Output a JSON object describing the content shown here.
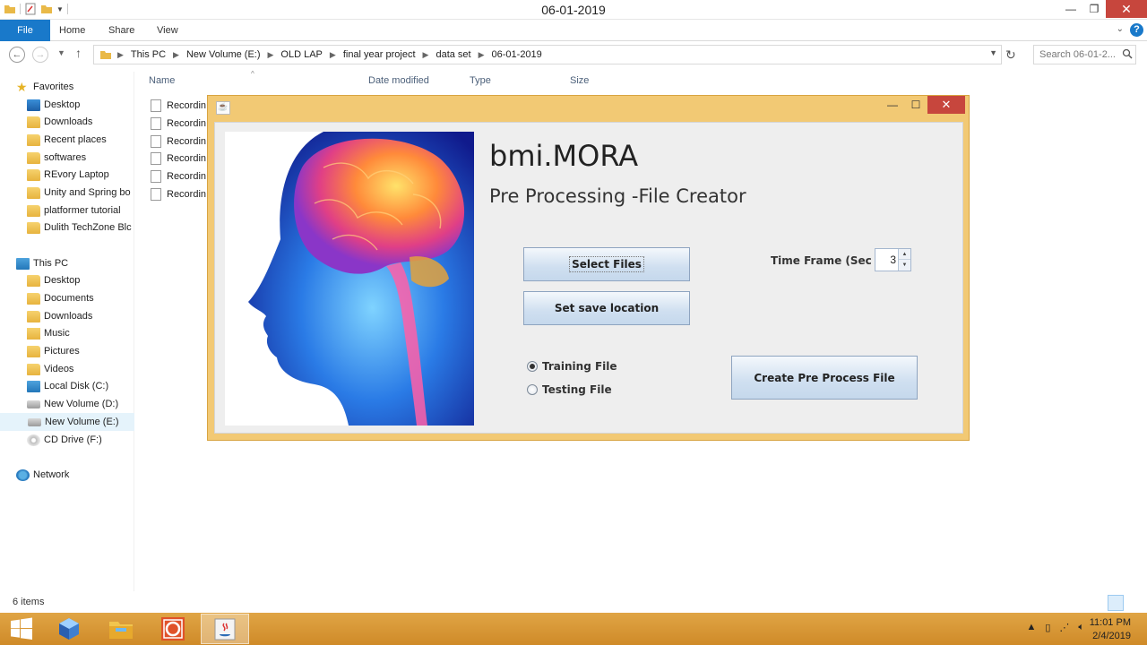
{
  "window": {
    "title": "06-01-2019"
  },
  "ribbon": {
    "tabs": [
      "File",
      "Home",
      "Share",
      "View"
    ]
  },
  "address": {
    "crumbs": [
      "This PC",
      "New Volume (E:)",
      "OLD LAP",
      "final year project",
      "data set",
      "06-01-2019"
    ],
    "search_placeholder": "Search 06-01-2..."
  },
  "nav": {
    "favorites_label": "Favorites",
    "favorites": [
      "Desktop",
      "Downloads",
      "Recent places",
      "softwares",
      "REvory Laptop",
      "Unity and Spring bo",
      "platformer tutorial",
      "Dulith TechZone Blc"
    ],
    "thispc_label": "This PC",
    "thispc": [
      "Desktop",
      "Documents",
      "Downloads",
      "Music",
      "Pictures",
      "Videos",
      "Local Disk (C:)",
      "New Volume (D:)",
      "New Volume (E:)",
      "CD Drive (F:)"
    ],
    "network_label": "Network"
  },
  "filelist": {
    "columns": [
      "Name",
      "Date modified",
      "Type",
      "Size"
    ],
    "rows": [
      "Recordin",
      "Recordin",
      "Recordin",
      "Recordin",
      "Recordin",
      "Recordin"
    ]
  },
  "status": {
    "count": "6 items"
  },
  "dialog": {
    "app_title": "bmi.MORA",
    "subtitle": "Pre Processing -File Creator",
    "select_files": "Select Files",
    "save_location": "Set save location",
    "time_frame_label": "Time Frame (Sec )",
    "time_frame_value": "3",
    "training_label": "Training File",
    "testing_label": "Testing File",
    "training_selected": true,
    "create_button": "Create Pre Process File"
  },
  "taskbar": {
    "time": "11:01 PM",
    "date": "2/4/2019"
  },
  "colors": {
    "accent": "#1979ca",
    "dialog_frame": "#f2c974",
    "taskbar": "#d9952f",
    "close": "#c7463d"
  }
}
